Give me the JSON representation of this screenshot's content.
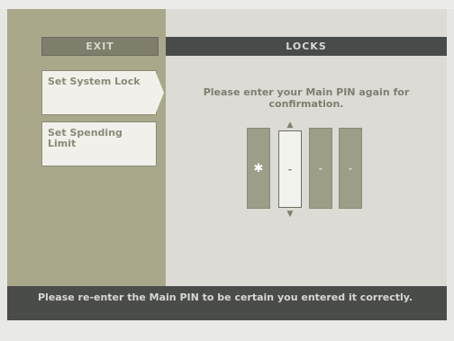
{
  "menu": {
    "exit_label": "EXIT",
    "items": [
      {
        "label": "Set System Lock"
      },
      {
        "label": "Set Spending Limit"
      }
    ]
  },
  "header": {
    "title": "LOCKS"
  },
  "pin": {
    "prompt": "Please enter your Main PIN again for confirmation.",
    "slots": [
      "✱",
      "-",
      "-",
      "-"
    ],
    "up_icon": "chevron-up-icon",
    "down_icon": "chevron-down-icon"
  },
  "help": {
    "text": "Please re-enter the Main PIN to be certain you entered it correctly."
  },
  "colors": {
    "left_panel": "#a9a88b",
    "right_panel": "#dcdbd5",
    "title_bar": "#484b49",
    "help_bar": "#4a4c4a",
    "selected_slot": "#f2f2ee"
  }
}
